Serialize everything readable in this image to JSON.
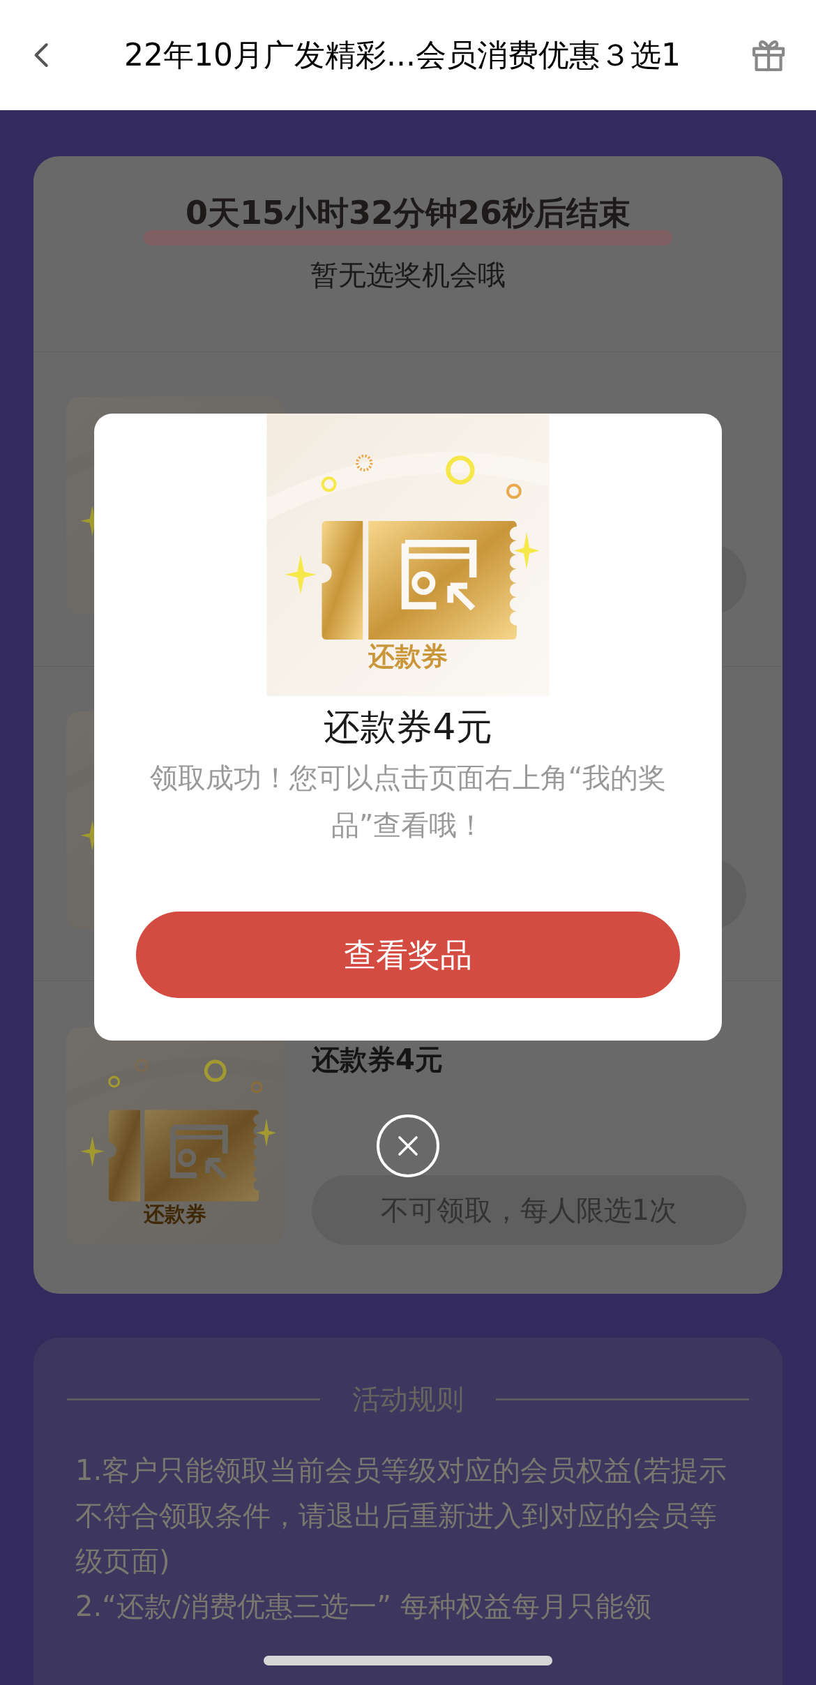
{
  "header": {
    "title": "22年10月广发精彩...会员消费优惠３选1"
  },
  "countdown": "0天15小时32分钟26秒后结束",
  "status": "暂无选奖机会哦",
  "prizes": [
    {
      "kind": "covered"
    },
    {
      "kind": "covered"
    },
    {
      "kind": "prize",
      "thumbnail_label": "还款券",
      "title": "还款券4元",
      "button": "不可领取，每人限选1次",
      "disabled": true
    }
  ],
  "modal": {
    "image_label": "还款券",
    "title": "还款券4元",
    "message": "领取成功！您可以点击页面右上角“我的奖品”查看哦！",
    "button": "查看奖品"
  },
  "rules": {
    "title": "活动规则",
    "items": [
      "1.客户只能领取当前会员等级对应的会员权益(若提示不符合领取条件，请退出后重新进入到对应的会员等级页面)",
      "2.“还款/消费优惠三选一” 每种权益每月只能领"
    ]
  }
}
